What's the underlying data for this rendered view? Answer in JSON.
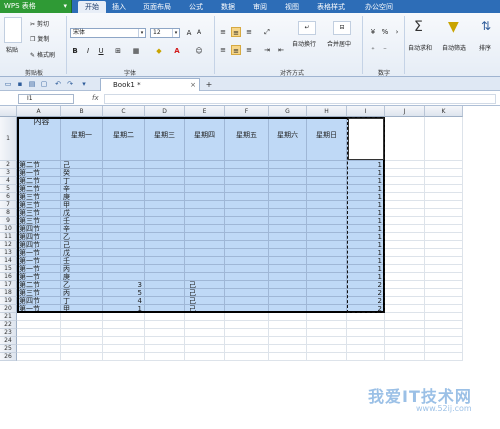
{
  "app": {
    "name": "WPS 表格",
    "caret": "▾"
  },
  "ribbon_tabs": [
    "开始",
    "插入",
    "页面布局",
    "公式",
    "数据",
    "审阅",
    "视图",
    "表格样式",
    "办公空间"
  ],
  "clipboard": {
    "paste": "粘贴",
    "cut": "剪切",
    "copy": "复制",
    "format_painter": "格式刷",
    "label": "剪贴板"
  },
  "font": {
    "name": "宋体",
    "size": "12",
    "label": "字体"
  },
  "alignment": {
    "label": "对齐方式",
    "wrap": "自动换行",
    "merge": "合并居中"
  },
  "number": {
    "label": "数字",
    "percent": "%"
  },
  "actions": {
    "autosum": "自动求和",
    "autofilter": "自动筛选",
    "sort": "排序"
  },
  "document": {
    "tab": "Book1 *",
    "close": "×",
    "add": "+"
  },
  "formula_bar": {
    "cell": "I1",
    "fx": "fx",
    "value": ""
  },
  "columns": [
    "A",
    "B",
    "C",
    "D",
    "E",
    "F",
    "G",
    "H",
    "I",
    "J",
    "K"
  ],
  "rows": [
    "1",
    "2",
    "3",
    "4",
    "5",
    "6",
    "7",
    "8",
    "9",
    "10",
    "11",
    "12",
    "13",
    "14",
    "15",
    "16",
    "17",
    "18",
    "19",
    "20",
    "21",
    "22",
    "23",
    "24",
    "25",
    "26"
  ],
  "header_row": {
    "a": "内容",
    "b": "星期一",
    "c": "星期二",
    "d": "星期三",
    "e": "星期四",
    "f": "星期五",
    "g": "星期六",
    "h": "星期日"
  },
  "data_rows": [
    {
      "a": "第二节",
      "b": "己",
      "c": "",
      "e": "",
      "i": "1"
    },
    {
      "a": "第一节",
      "b": "癸",
      "c": "",
      "e": "",
      "i": "1"
    },
    {
      "a": "第二节",
      "b": "丁",
      "c": "",
      "e": "",
      "i": "1"
    },
    {
      "a": "第二节",
      "b": "辛",
      "c": "",
      "e": "",
      "i": "1"
    },
    {
      "a": "第三节",
      "b": "庚",
      "c": "",
      "e": "",
      "i": "1"
    },
    {
      "a": "第三节",
      "b": "甲",
      "c": "",
      "e": "",
      "i": "1"
    },
    {
      "a": "第三节",
      "b": "戊",
      "c": "",
      "e": "",
      "i": "1"
    },
    {
      "a": "第三节",
      "b": "壬",
      "c": "",
      "e": "",
      "i": "1"
    },
    {
      "a": "第四节",
      "b": "辛",
      "c": "",
      "e": "",
      "i": "1"
    },
    {
      "a": "第四节",
      "b": "乙",
      "c": "",
      "e": "",
      "i": "1"
    },
    {
      "a": "第四节",
      "b": "己",
      "c": "",
      "e": "",
      "i": "1"
    },
    {
      "a": "第一节",
      "b": "戊",
      "c": "",
      "e": "",
      "i": "1"
    },
    {
      "a": "第一节",
      "b": "壬",
      "c": "",
      "e": "",
      "i": "1"
    },
    {
      "a": "第一节",
      "b": "丙",
      "c": "",
      "e": "",
      "i": "1"
    },
    {
      "a": "第一节",
      "b": "庚",
      "c": "",
      "e": "",
      "i": "1"
    },
    {
      "a": "第二节",
      "b": "乙",
      "c": "3",
      "e": "己",
      "i": "2"
    },
    {
      "a": "第三节",
      "b": "丙",
      "c": "5",
      "e": "己",
      "i": "2"
    },
    {
      "a": "第四节",
      "b": "丁",
      "c": "4",
      "e": "己",
      "i": "2"
    },
    {
      "a": "第一节",
      "b": "甲",
      "c": "1",
      "e": "己",
      "i": "2"
    }
  ],
  "watermark": {
    "text": "我爱IT技术网",
    "url": "www.52ij.com"
  },
  "colors": {
    "tab_bar": "#2d6db7",
    "app_button": "#2f9a35",
    "selection": "#bfd9f6"
  }
}
